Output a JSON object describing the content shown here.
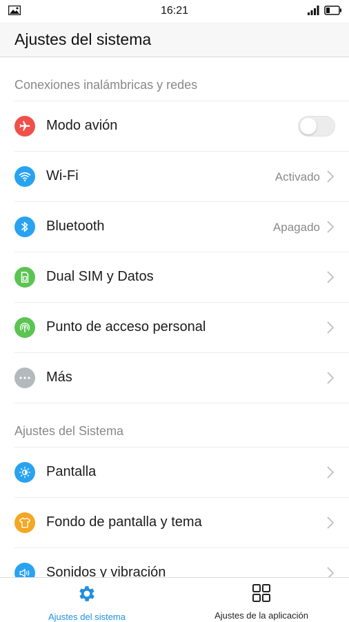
{
  "status_bar": {
    "time": "16:21"
  },
  "app_bar": {
    "title": "Ajustes del sistema"
  },
  "sections": [
    {
      "header": "Conexiones inalámbricas y redes",
      "items": [
        {
          "label": "Modo avión",
          "value": "",
          "icon": "airplane-icon",
          "color": "#f0504a",
          "toggle": false
        },
        {
          "label": "Wi-Fi",
          "value": "Activado",
          "icon": "wifi-icon",
          "color": "#29a3f0"
        },
        {
          "label": "Bluetooth",
          "value": "Apagado",
          "icon": "bluetooth-icon",
          "color": "#29a3f0"
        },
        {
          "label": "Dual SIM y Datos",
          "value": "",
          "icon": "sim-card-icon",
          "color": "#5cc452"
        },
        {
          "label": "Punto de acceso personal",
          "value": "",
          "icon": "hotspot-icon",
          "color": "#5cc452"
        },
        {
          "label": "Más",
          "value": "",
          "icon": "more-icon",
          "color": "#b4b9bd"
        }
      ]
    },
    {
      "header": "Ajustes del Sistema",
      "items": [
        {
          "label": "Pantalla",
          "value": "",
          "icon": "display-icon",
          "color": "#29a3f0"
        },
        {
          "label": "Fondo de pantalla y tema",
          "value": "",
          "icon": "shirt-icon",
          "color": "#f5a623"
        },
        {
          "label": "Sonidos y vibración",
          "value": "",
          "icon": "speaker-icon",
          "color": "#29a3f0"
        }
      ]
    }
  ],
  "bottom_nav": {
    "tabs": [
      {
        "label": "Ajustes del sistema",
        "icon": "gear-icon",
        "active": true,
        "color": "#1f8fe0"
      },
      {
        "label": "Ajustes de la aplicación",
        "icon": "grid-icon",
        "active": false,
        "color": "#222222"
      }
    ]
  }
}
